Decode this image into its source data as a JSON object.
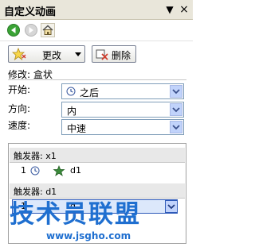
{
  "panel": {
    "title": "自定义动画",
    "menu_glyph": "▼",
    "close_glyph": "×"
  },
  "toolbar": {
    "change_label": "更改",
    "delete_label": "删除"
  },
  "modify": {
    "caption": "修改: 盒状"
  },
  "fields": {
    "start": {
      "label": "开始:",
      "value": "之后"
    },
    "direction": {
      "label": "方向:",
      "value": "内"
    },
    "speed": {
      "label": "速度:",
      "value": "中速"
    }
  },
  "list": {
    "trigger1": {
      "header": "触发器: x1",
      "num": "1",
      "name": "d1"
    },
    "trigger2": {
      "header": "触发器: d1",
      "num": "1",
      "name": "d"
    }
  },
  "watermark": {
    "text": "技术员联盟",
    "url": "www.jsgho.com"
  },
  "colors": {
    "panel_bg": "#e9e6da",
    "select_border": "#7f9db9",
    "dropdown_button": "#c1d3fb",
    "watermark": "#1f6fd0"
  },
  "icons": [
    "back-icon",
    "forward-icon",
    "home-icon",
    "star-change-icon",
    "delete-icon",
    "clock-icon",
    "star-effect-icon",
    "dropdown-arrow-icon"
  ]
}
